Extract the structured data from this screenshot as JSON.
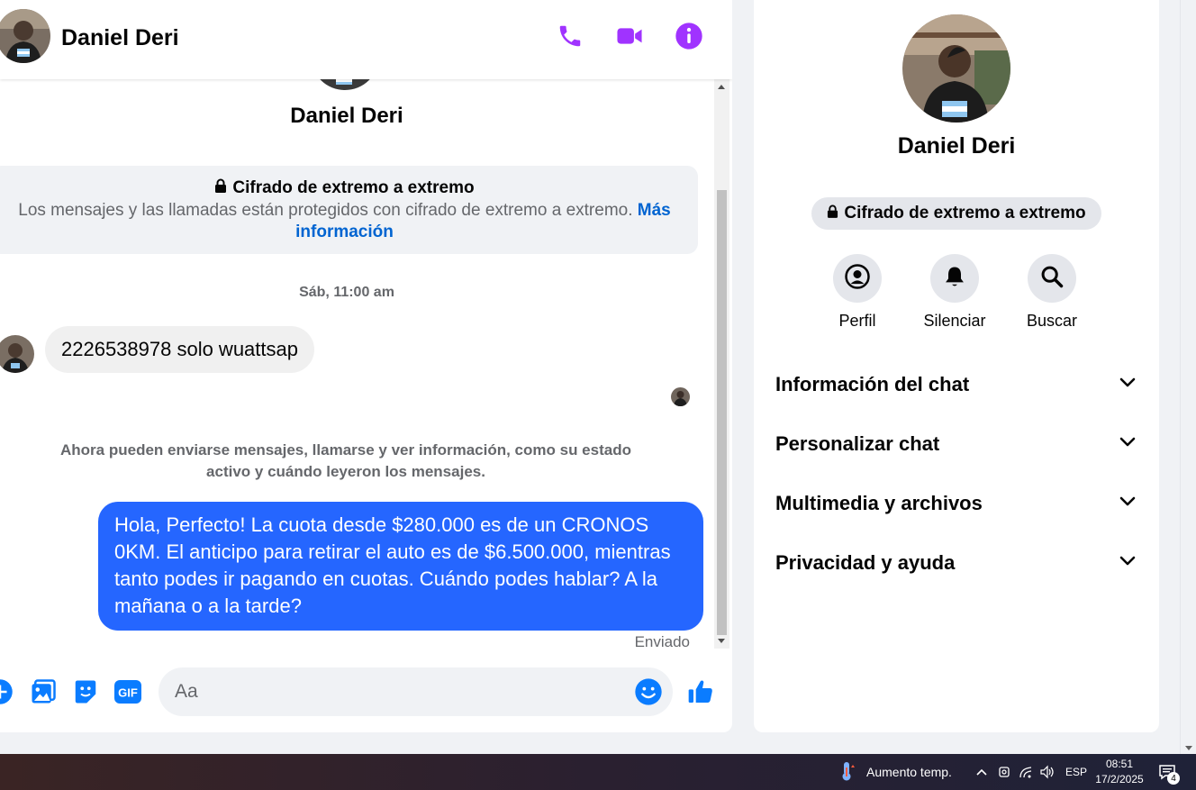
{
  "header": {
    "contact_name": "Daniel Deri",
    "icons": [
      "phone-icon",
      "video-camera-icon",
      "info-icon"
    ]
  },
  "conversation": {
    "profile_name": "Daniel Deri",
    "e2e_title": "Cifrado de extremo a extremo",
    "e2e_text": "Los mensajes y las llamadas están protegidos con cifrado de extremo a extremo.",
    "e2e_link": "Más información",
    "timestamp": "Sáb, 11:00 am",
    "incoming_message": "2226538978 solo wuattsap",
    "info_note": "Ahora pueden enviarse mensajes, llamarse y ver información, como su estado activo y cuándo leyeron los mensajes.",
    "outgoing_message": "Hola, Perfecto! La cuota desde $280.000 es de un CRONOS 0KM. El anticipo para retirar el auto es de $6.500.000, mientras tanto podes ir pagando en cuotas. Cuándo podes hablar? A la mañana o a la tarde?",
    "sent_status": "Enviado"
  },
  "composer": {
    "placeholder": "Aa",
    "gif_label": "GIF"
  },
  "info_panel": {
    "name": "Daniel Deri",
    "e2e_badge": "Cifrado de extremo a extremo",
    "actions": [
      {
        "label": "Perfil",
        "icon": "profile-icon"
      },
      {
        "label": "Silenciar",
        "icon": "bell-icon"
      },
      {
        "label": "Buscar",
        "icon": "search-icon"
      }
    ],
    "sections": [
      {
        "label": "Información del chat"
      },
      {
        "label": "Personalizar chat"
      },
      {
        "label": "Multimedia y archivos"
      },
      {
        "label": "Privacidad y ayuda"
      }
    ]
  },
  "taskbar": {
    "weather": "Aumento temp.",
    "language": "ESP",
    "time": "08:51",
    "date": "17/2/2025",
    "notification_count": "4"
  },
  "colors": {
    "accent_purple": "#a033ff",
    "messenger_blue": "#0a7cff",
    "bubble_blue": "#2566ff"
  }
}
